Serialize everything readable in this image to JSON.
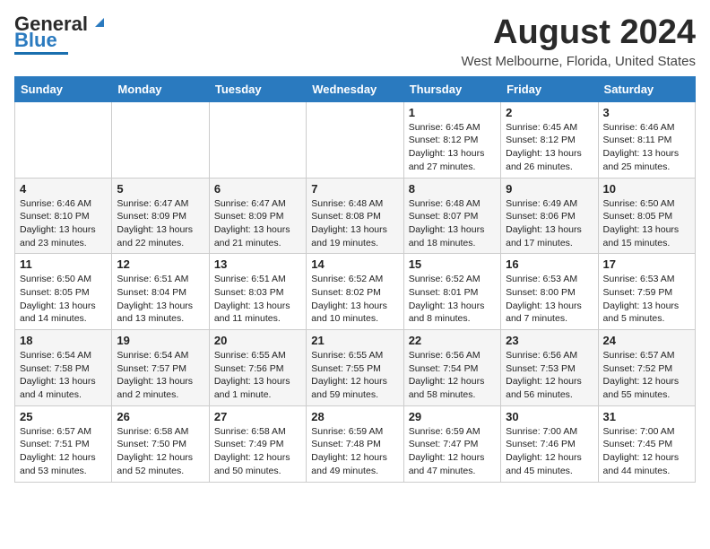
{
  "header": {
    "logo_general": "General",
    "logo_blue": "Blue",
    "main_title": "August 2024",
    "subtitle": "West Melbourne, Florida, United States"
  },
  "calendar": {
    "weekdays": [
      "Sunday",
      "Monday",
      "Tuesday",
      "Wednesday",
      "Thursday",
      "Friday",
      "Saturday"
    ],
    "weeks": [
      [
        {
          "day": "",
          "info": ""
        },
        {
          "day": "",
          "info": ""
        },
        {
          "day": "",
          "info": ""
        },
        {
          "day": "",
          "info": ""
        },
        {
          "day": "1",
          "info": "Sunrise: 6:45 AM\nSunset: 8:12 PM\nDaylight: 13 hours\nand 27 minutes."
        },
        {
          "day": "2",
          "info": "Sunrise: 6:45 AM\nSunset: 8:12 PM\nDaylight: 13 hours\nand 26 minutes."
        },
        {
          "day": "3",
          "info": "Sunrise: 6:46 AM\nSunset: 8:11 PM\nDaylight: 13 hours\nand 25 minutes."
        }
      ],
      [
        {
          "day": "4",
          "info": "Sunrise: 6:46 AM\nSunset: 8:10 PM\nDaylight: 13 hours\nand 23 minutes."
        },
        {
          "day": "5",
          "info": "Sunrise: 6:47 AM\nSunset: 8:09 PM\nDaylight: 13 hours\nand 22 minutes."
        },
        {
          "day": "6",
          "info": "Sunrise: 6:47 AM\nSunset: 8:09 PM\nDaylight: 13 hours\nand 21 minutes."
        },
        {
          "day": "7",
          "info": "Sunrise: 6:48 AM\nSunset: 8:08 PM\nDaylight: 13 hours\nand 19 minutes."
        },
        {
          "day": "8",
          "info": "Sunrise: 6:48 AM\nSunset: 8:07 PM\nDaylight: 13 hours\nand 18 minutes."
        },
        {
          "day": "9",
          "info": "Sunrise: 6:49 AM\nSunset: 8:06 PM\nDaylight: 13 hours\nand 17 minutes."
        },
        {
          "day": "10",
          "info": "Sunrise: 6:50 AM\nSunset: 8:05 PM\nDaylight: 13 hours\nand 15 minutes."
        }
      ],
      [
        {
          "day": "11",
          "info": "Sunrise: 6:50 AM\nSunset: 8:05 PM\nDaylight: 13 hours\nand 14 minutes."
        },
        {
          "day": "12",
          "info": "Sunrise: 6:51 AM\nSunset: 8:04 PM\nDaylight: 13 hours\nand 13 minutes."
        },
        {
          "day": "13",
          "info": "Sunrise: 6:51 AM\nSunset: 8:03 PM\nDaylight: 13 hours\nand 11 minutes."
        },
        {
          "day": "14",
          "info": "Sunrise: 6:52 AM\nSunset: 8:02 PM\nDaylight: 13 hours\nand 10 minutes."
        },
        {
          "day": "15",
          "info": "Sunrise: 6:52 AM\nSunset: 8:01 PM\nDaylight: 13 hours\nand 8 minutes."
        },
        {
          "day": "16",
          "info": "Sunrise: 6:53 AM\nSunset: 8:00 PM\nDaylight: 13 hours\nand 7 minutes."
        },
        {
          "day": "17",
          "info": "Sunrise: 6:53 AM\nSunset: 7:59 PM\nDaylight: 13 hours\nand 5 minutes."
        }
      ],
      [
        {
          "day": "18",
          "info": "Sunrise: 6:54 AM\nSunset: 7:58 PM\nDaylight: 13 hours\nand 4 minutes."
        },
        {
          "day": "19",
          "info": "Sunrise: 6:54 AM\nSunset: 7:57 PM\nDaylight: 13 hours\nand 2 minutes."
        },
        {
          "day": "20",
          "info": "Sunrise: 6:55 AM\nSunset: 7:56 PM\nDaylight: 13 hours\nand 1 minute."
        },
        {
          "day": "21",
          "info": "Sunrise: 6:55 AM\nSunset: 7:55 PM\nDaylight: 12 hours\nand 59 minutes."
        },
        {
          "day": "22",
          "info": "Sunrise: 6:56 AM\nSunset: 7:54 PM\nDaylight: 12 hours\nand 58 minutes."
        },
        {
          "day": "23",
          "info": "Sunrise: 6:56 AM\nSunset: 7:53 PM\nDaylight: 12 hours\nand 56 minutes."
        },
        {
          "day": "24",
          "info": "Sunrise: 6:57 AM\nSunset: 7:52 PM\nDaylight: 12 hours\nand 55 minutes."
        }
      ],
      [
        {
          "day": "25",
          "info": "Sunrise: 6:57 AM\nSunset: 7:51 PM\nDaylight: 12 hours\nand 53 minutes."
        },
        {
          "day": "26",
          "info": "Sunrise: 6:58 AM\nSunset: 7:50 PM\nDaylight: 12 hours\nand 52 minutes."
        },
        {
          "day": "27",
          "info": "Sunrise: 6:58 AM\nSunset: 7:49 PM\nDaylight: 12 hours\nand 50 minutes."
        },
        {
          "day": "28",
          "info": "Sunrise: 6:59 AM\nSunset: 7:48 PM\nDaylight: 12 hours\nand 49 minutes."
        },
        {
          "day": "29",
          "info": "Sunrise: 6:59 AM\nSunset: 7:47 PM\nDaylight: 12 hours\nand 47 minutes."
        },
        {
          "day": "30",
          "info": "Sunrise: 7:00 AM\nSunset: 7:46 PM\nDaylight: 12 hours\nand 45 minutes."
        },
        {
          "day": "31",
          "info": "Sunrise: 7:00 AM\nSunset: 7:45 PM\nDaylight: 12 hours\nand 44 minutes."
        }
      ]
    ]
  }
}
